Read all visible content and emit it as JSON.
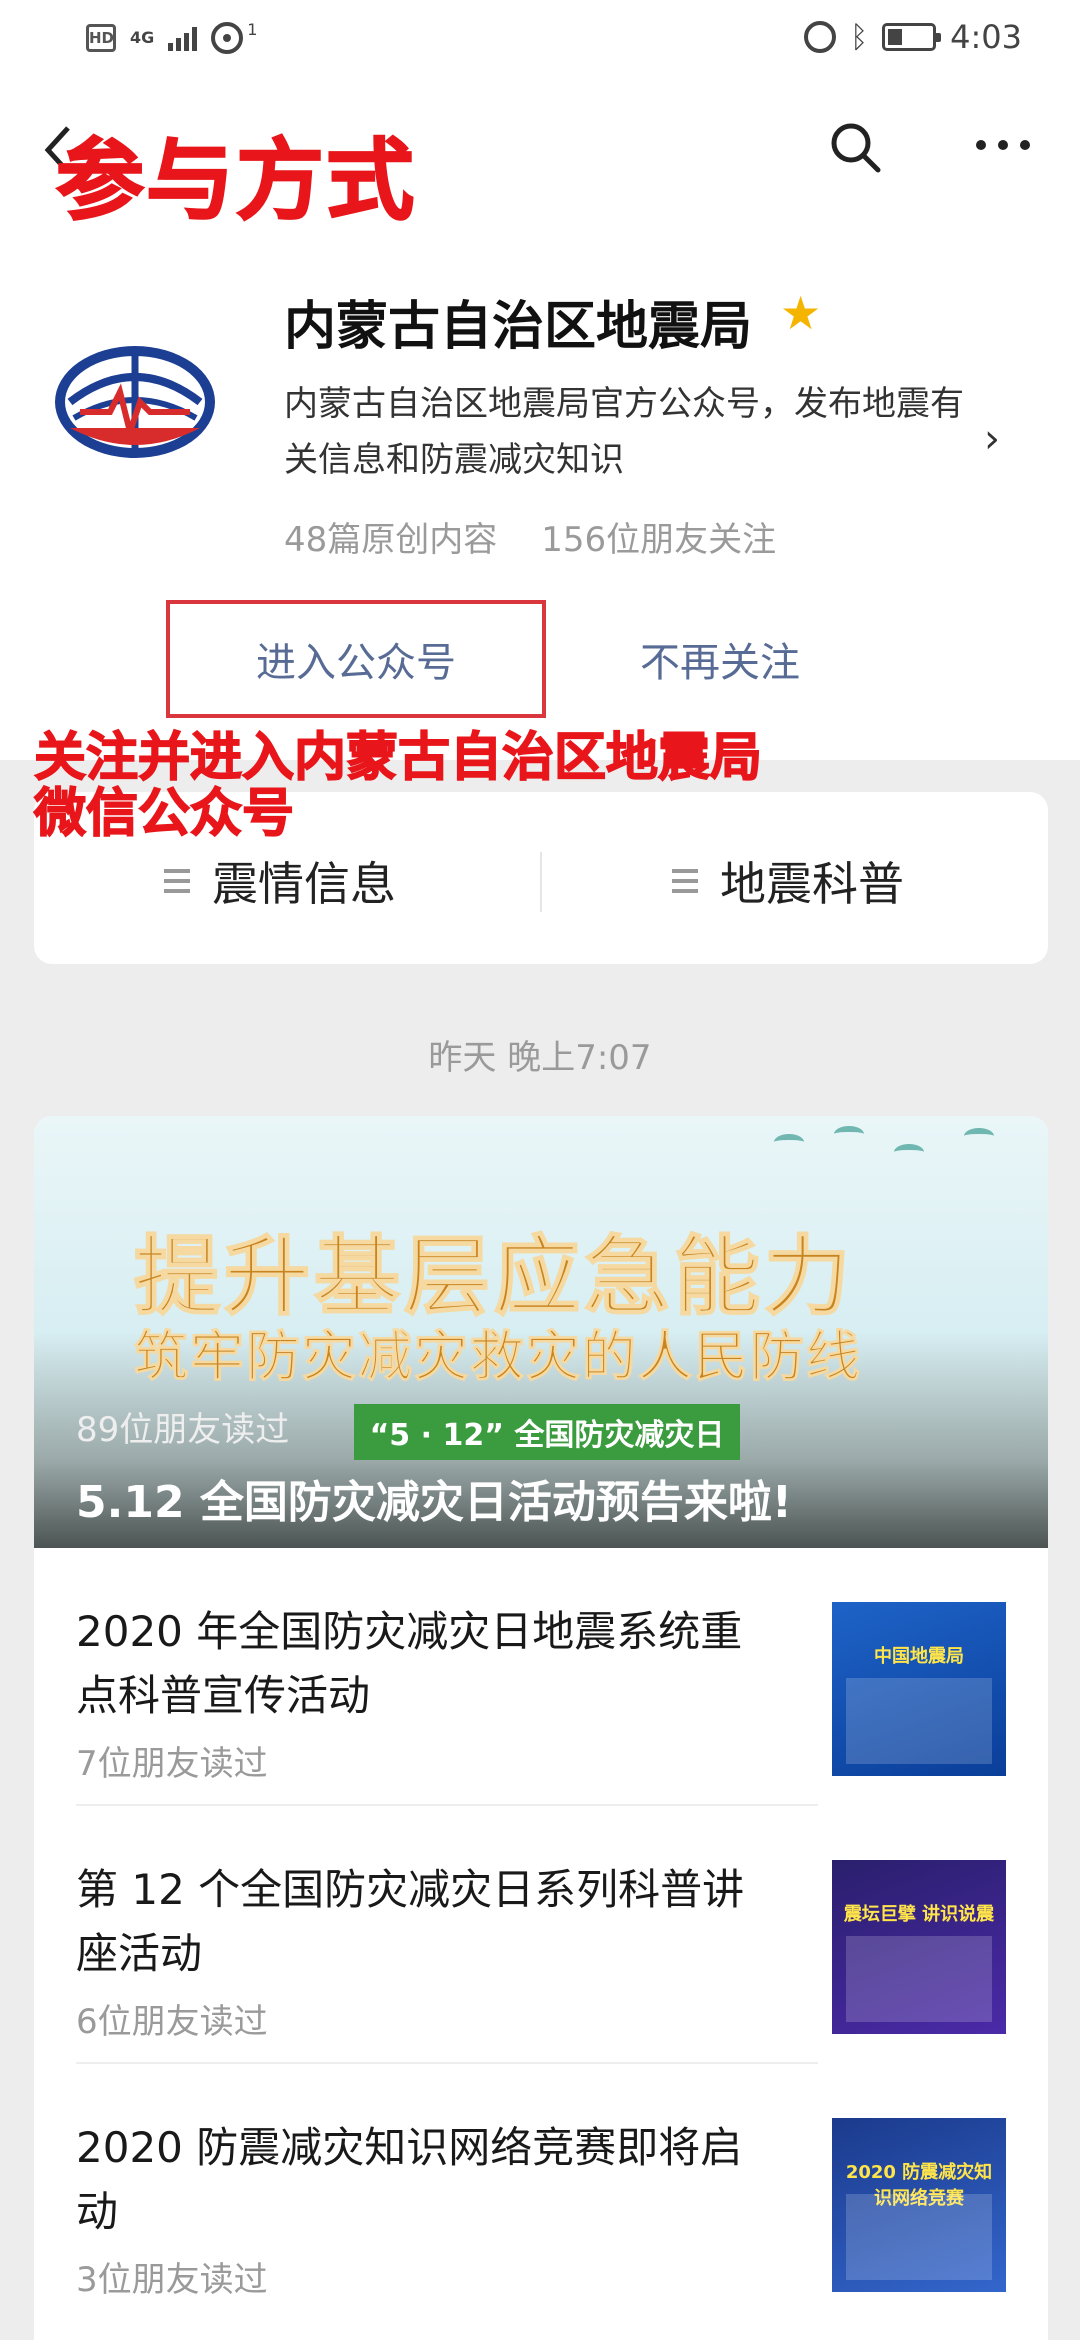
{
  "status_bar": {
    "hd": "HD",
    "network": "4G",
    "hotspot_count": "1",
    "time": "4:03"
  },
  "overlay": {
    "title": "参与方式",
    "note_line1": "关注并进入内蒙古自治区地震局",
    "note_line2": "微信公众号"
  },
  "account": {
    "name": "内蒙古自治区地震局",
    "description": "内蒙古自治区地震局官方公众号，发布地震有关信息和防震减灾知识",
    "stats_original": "48篇原创内容",
    "stats_followers": "156位朋友关注",
    "enter_label": "进入公众号",
    "unfollow_label": "不再关注",
    "star_color": "#f5b400"
  },
  "menu": [
    {
      "label": "震情信息"
    },
    {
      "label": "地震科普"
    }
  ],
  "date_label": "昨天 晚上7:07",
  "cover": {
    "headline1": "提升基层应急能力",
    "headline2": "筑牢防灾减灾救灾的人民防线",
    "banner": "“5 · 12” 全国防灾减灾日",
    "reads": "89位朋友读过",
    "title": "5.12 全国防灾减灾日活动预告来啦!"
  },
  "articles": [
    {
      "title": "2020 年全国防灾减灾日地震系统重点科普宣传活动",
      "reads": "7位朋友读过",
      "thumb_text": "中国地震局"
    },
    {
      "title": "第 12 个全国防灾减灾日系列科普讲座活动",
      "reads": "6位朋友读过",
      "thumb_text": "震坛巨擘 讲识说震"
    },
    {
      "title": "2020 防震减灾知识网络竞赛即将启动",
      "reads": "3位朋友读过",
      "thumb_text": "2020 防震减灾知识网络竞赛"
    }
  ],
  "colors": {
    "accent_link": "#576b95",
    "overlay_red": "#e8161a"
  }
}
